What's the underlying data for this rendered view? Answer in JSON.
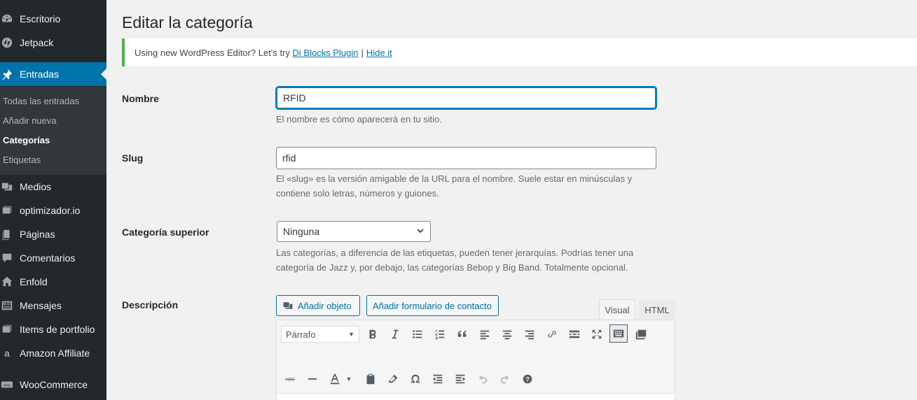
{
  "sidebar": {
    "items": [
      {
        "label": "Escritorio",
        "icon": "dashboard-icon"
      },
      {
        "label": "Jetpack",
        "icon": "jetpack-icon"
      },
      {
        "label": "Entradas",
        "icon": "pin-icon"
      },
      {
        "label": "Medios",
        "icon": "media-icon"
      },
      {
        "label": "optimizador.io",
        "icon": "optimizer-icon"
      },
      {
        "label": "Páginas",
        "icon": "pages-icon"
      },
      {
        "label": "Comentarios",
        "icon": "comments-icon"
      },
      {
        "label": "Enfold",
        "icon": "home-icon"
      },
      {
        "label": "Mensajes",
        "icon": "messages-icon"
      },
      {
        "label": "Items de portfolio",
        "icon": "portfolio-icon"
      },
      {
        "label": "Amazon Affiliate",
        "icon": "amazon-icon"
      },
      {
        "label": "WooCommerce",
        "icon": "woo-icon"
      }
    ],
    "submenu": [
      "Todas las entradas",
      "Añadir nueva",
      "Categorías",
      "Etiquetas"
    ],
    "accent": "#0073aa"
  },
  "page": {
    "title": "Editar la categoría"
  },
  "notice": {
    "text": "Using new WordPress Editor? Let's try",
    "link1": "Di Blocks Plugin",
    "separator": "|",
    "link2": "Hide it"
  },
  "form": {
    "name_label": "Nombre",
    "name_value": "RFID",
    "name_help": "El nombre es cómo aparecerá en tu sitio.",
    "slug_label": "Slug",
    "slug_value": "rfid",
    "slug_help": "El «slug» es la versión amigable de la URL para el nombre. Suele estar en minúsculas y contiene solo letras, números y guiones.",
    "parent_label": "Categoría superior",
    "parent_value": "Ninguna",
    "parent_help": "Las categorías, a diferencia de las etiquetas, pueden tener jerarquías. Podrías tener una categoría de Jazz y, por debajo, las categorías Bebop y Big Band. Totalmente opcional.",
    "description_label": "Descripción"
  },
  "editor": {
    "add_media": "Añadir objeto",
    "add_form": "Añadir formulario de contacto",
    "tab_visual": "Visual",
    "tab_html": "HTML",
    "format_value": "Párrafo"
  }
}
